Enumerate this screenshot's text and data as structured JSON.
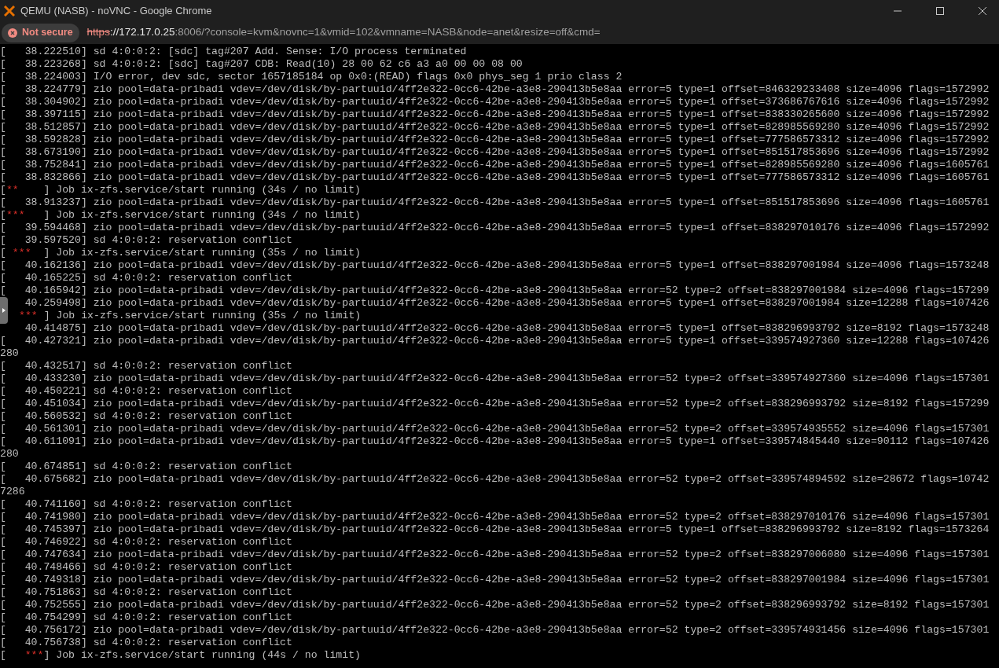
{
  "window": {
    "title": "QEMU (NASB) - noVNC - Google Chrome"
  },
  "address_bar": {
    "security_chip": "Not secure",
    "url_scheme": "https",
    "url_host": "://172.17.0.25",
    "url_rest": ":8006/?console=kvm&novnc=1&vmid=102&vmname=NASB&node=anet&resize=off&cmd="
  },
  "console": {
    "lines": [
      {
        "kind": "log",
        "text": "[   38.222510] sd 4:0:0:2: [sdc] tag#207 Add. Sense: I/O process terminated"
      },
      {
        "kind": "log",
        "text": "[   38.223268] sd 4:0:0:2: [sdc] tag#207 CDB: Read(10) 28 00 62 c6 a3 a0 00 00 08 00"
      },
      {
        "kind": "log",
        "text": "[   38.224003] I/O error, dev sdc, sector 1657185184 op 0x0:(READ) flags 0x0 phys_seg 1 prio class 2"
      },
      {
        "kind": "log",
        "text": "[   38.224779] zio pool=data-pribadi vdev=/dev/disk/by-partuuid/4ff2e322-0cc6-42be-a3e8-290413b5e8aa error=5 type=1 offset=846329233408 size=4096 flags=1572992"
      },
      {
        "kind": "log",
        "text": "[   38.304902] zio pool=data-pribadi vdev=/dev/disk/by-partuuid/4ff2e322-0cc6-42be-a3e8-290413b5e8aa error=5 type=1 offset=373686767616 size=4096 flags=1572992"
      },
      {
        "kind": "log",
        "text": "[   38.397115] zio pool=data-pribadi vdev=/dev/disk/by-partuuid/4ff2e322-0cc6-42be-a3e8-290413b5e8aa error=5 type=1 offset=838330265600 size=4096 flags=1572992"
      },
      {
        "kind": "log",
        "text": "[   38.512857] zio pool=data-pribadi vdev=/dev/disk/by-partuuid/4ff2e322-0cc6-42be-a3e8-290413b5e8aa error=5 type=1 offset=828985569280 size=4096 flags=1572992"
      },
      {
        "kind": "log",
        "text": "[   38.592828] zio pool=data-pribadi vdev=/dev/disk/by-partuuid/4ff2e322-0cc6-42be-a3e8-290413b5e8aa error=5 type=1 offset=777586573312 size=4096 flags=1572992"
      },
      {
        "kind": "log",
        "text": "[   38.673190] zio pool=data-pribadi vdev=/dev/disk/by-partuuid/4ff2e322-0cc6-42be-a3e8-290413b5e8aa error=5 type=1 offset=851517853696 size=4096 flags=1572992"
      },
      {
        "kind": "log",
        "text": "[   38.752841] zio pool=data-pribadi vdev=/dev/disk/by-partuuid/4ff2e322-0cc6-42be-a3e8-290413b5e8aa error=5 type=1 offset=828985569280 size=4096 flags=1605761"
      },
      {
        "kind": "log",
        "text": "[   38.832866] zio pool=data-pribadi vdev=/dev/disk/by-partuuid/4ff2e322-0cc6-42be-a3e8-290413b5e8aa error=5 type=1 offset=777586573312 size=4096 flags=1605761"
      },
      {
        "kind": "job",
        "open": "[",
        "marker": "**",
        "close": "    ] Job ix-zfs.service/start running (34s / no limit)"
      },
      {
        "kind": "log",
        "text": "[   38.913237] zio pool=data-pribadi vdev=/dev/disk/by-partuuid/4ff2e322-0cc6-42be-a3e8-290413b5e8aa error=5 type=1 offset=851517853696 size=4096 flags=1605761"
      },
      {
        "kind": "job",
        "open": "[",
        "marker": "***",
        "close": "   ] Job ix-zfs.service/start running (34s / no limit)"
      },
      {
        "kind": "log",
        "text": "[   39.594468] zio pool=data-pribadi vdev=/dev/disk/by-partuuid/4ff2e322-0cc6-42be-a3e8-290413b5e8aa error=5 type=1 offset=838297010176 size=4096 flags=1572992"
      },
      {
        "kind": "log",
        "text": "[   39.597520] sd 4:0:0:2: reservation conflict"
      },
      {
        "kind": "job",
        "open": "[ ",
        "marker": "***",
        "close": "  ] Job ix-zfs.service/start running (35s / no limit)"
      },
      {
        "kind": "log",
        "text": "[   40.162136] zio pool=data-pribadi vdev=/dev/disk/by-partuuid/4ff2e322-0cc6-42be-a3e8-290413b5e8aa error=5 type=1 offset=838297001984 size=4096 flags=1573248"
      },
      {
        "kind": "log",
        "text": "[   40.165225] sd 4:0:0:2: reservation conflict"
      },
      {
        "kind": "log",
        "text": "[   40.165942] zio pool=data-pribadi vdev=/dev/disk/by-partuuid/4ff2e322-0cc6-42be-a3e8-290413b5e8aa error=52 type=2 offset=838297001984 size=4096 flags=157299"
      },
      {
        "kind": "log",
        "text": "    40.259498] zio pool=data-pribadi vdev=/dev/disk/by-partuuid/4ff2e322-0cc6-42be-a3e8-290413b5e8aa error=5 type=1 offset=838297001984 size=12288 flags=107426"
      },
      {
        "kind": "job",
        "marker": "***",
        "close": " ] Job ix-zfs.service/start running (35s / no limit)"
      },
      {
        "kind": "log",
        "text": "    40.414875] zio pool=data-pribadi vdev=/dev/disk/by-partuuid/4ff2e322-0cc6-42be-a3e8-290413b5e8aa error=5 type=1 offset=838296993792 size=8192 flags=1573248"
      },
      {
        "kind": "log",
        "text": "[   40.427321] zio pool=data-pribadi vdev=/dev/disk/by-partuuid/4ff2e322-0cc6-42be-a3e8-290413b5e8aa error=5 type=1 offset=339574927360 size=12288 flags=107426"
      },
      {
        "kind": "log",
        "text": "280"
      },
      {
        "kind": "log",
        "text": "[   40.432517] sd 4:0:0:2: reservation conflict"
      },
      {
        "kind": "log",
        "text": "[   40.433230] zio pool=data-pribadi vdev=/dev/disk/by-partuuid/4ff2e322-0cc6-42be-a3e8-290413b5e8aa error=52 type=2 offset=339574927360 size=4096 flags=157301"
      },
      {
        "kind": "log",
        "text": "[   40.450221] sd 4:0:0:2: reservation conflict"
      },
      {
        "kind": "log",
        "text": "[   40.451034] zio pool=data-pribadi vdev=/dev/disk/by-partuuid/4ff2e322-0cc6-42be-a3e8-290413b5e8aa error=52 type=2 offset=838296993792 size=8192 flags=157299"
      },
      {
        "kind": "log",
        "text": "[   40.560532] sd 4:0:0:2: reservation conflict"
      },
      {
        "kind": "log",
        "text": "[   40.561301] zio pool=data-pribadi vdev=/dev/disk/by-partuuid/4ff2e322-0cc6-42be-a3e8-290413b5e8aa error=52 type=2 offset=339574935552 size=4096 flags=157301"
      },
      {
        "kind": "log",
        "text": "[   40.611091] zio pool=data-pribadi vdev=/dev/disk/by-partuuid/4ff2e322-0cc6-42be-a3e8-290413b5e8aa error=5 type=1 offset=339574845440 size=90112 flags=107426"
      },
      {
        "kind": "log",
        "text": "280"
      },
      {
        "kind": "log",
        "text": "[   40.674851] sd 4:0:0:2: reservation conflict"
      },
      {
        "kind": "log",
        "text": "[   40.675682] zio pool=data-pribadi vdev=/dev/disk/by-partuuid/4ff2e322-0cc6-42be-a3e8-290413b5e8aa error=52 type=2 offset=339574894592 size=28672 flags=10742"
      },
      {
        "kind": "log",
        "text": "7286"
      },
      {
        "kind": "log",
        "text": "[   40.741160] sd 4:0:0:2: reservation conflict"
      },
      {
        "kind": "log",
        "text": "[   40.741980] zio pool=data-pribadi vdev=/dev/disk/by-partuuid/4ff2e322-0cc6-42be-a3e8-290413b5e8aa error=52 type=2 offset=838297010176 size=4096 flags=157301"
      },
      {
        "kind": "log",
        "text": "[   40.745397] zio pool=data-pribadi vdev=/dev/disk/by-partuuid/4ff2e322-0cc6-42be-a3e8-290413b5e8aa error=5 type=1 offset=838296993792 size=8192 flags=1573264"
      },
      {
        "kind": "log",
        "text": "[   40.746922] sd 4:0:0:2: reservation conflict"
      },
      {
        "kind": "log",
        "text": "[   40.747634] zio pool=data-pribadi vdev=/dev/disk/by-partuuid/4ff2e322-0cc6-42be-a3e8-290413b5e8aa error=52 type=2 offset=838297006080 size=4096 flags=157301"
      },
      {
        "kind": "log",
        "text": "[   40.748466] sd 4:0:0:2: reservation conflict"
      },
      {
        "kind": "log",
        "text": "[   40.749318] zio pool=data-pribadi vdev=/dev/disk/by-partuuid/4ff2e322-0cc6-42be-a3e8-290413b5e8aa error=52 type=2 offset=838297001984 size=4096 flags=157301"
      },
      {
        "kind": "log",
        "text": "[   40.751863] sd 4:0:0:2: reservation conflict"
      },
      {
        "kind": "log",
        "text": "[   40.752555] zio pool=data-pribadi vdev=/dev/disk/by-partuuid/4ff2e322-0cc6-42be-a3e8-290413b5e8aa error=52 type=2 offset=838296993792 size=8192 flags=157301"
      },
      {
        "kind": "log",
        "text": "[   40.754299] sd 4:0:0:2: reservation conflict"
      },
      {
        "kind": "log",
        "text": "[   40.756172] zio pool=data-pribadi vdev=/dev/disk/by-partuuid/4ff2e322-0cc6-42be-a3e8-290413b5e8aa error=52 type=2 offset=339574931456 size=4096 flags=157301"
      },
      {
        "kind": "log",
        "text": "[   40.756738] sd 4:0:0:2: reservation conflict"
      },
      {
        "kind": "job",
        "open": "[   ",
        "marker": "***",
        "close": "] Job ix-zfs.service/start running (44s / no limit)"
      }
    ]
  }
}
